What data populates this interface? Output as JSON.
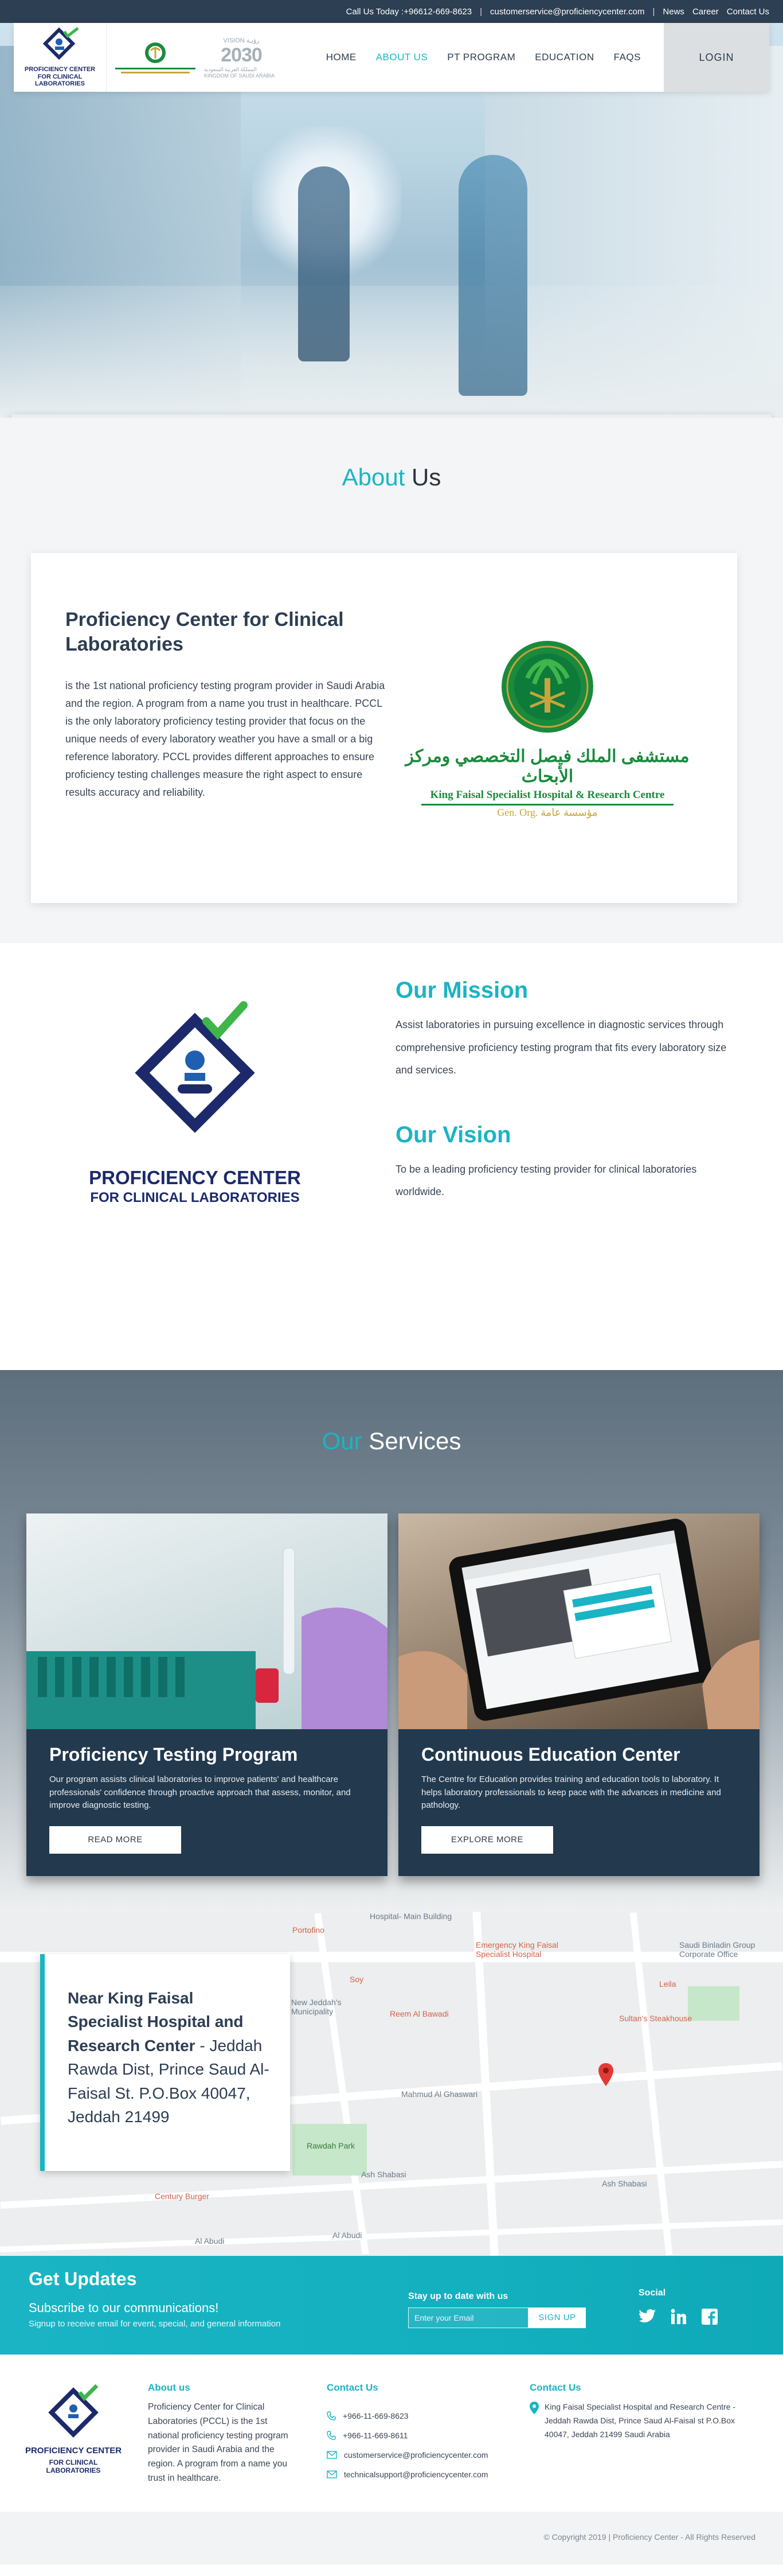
{
  "topbar": {
    "call": "Call Us Today :+96612-669-8623",
    "email": "customerservice@proficiencycenter.com",
    "links": [
      "News",
      "Career",
      "Contact Us"
    ],
    "separator": "|"
  },
  "header": {
    "logo_line1": "PROFICIENCY CENTER",
    "logo_line2": "FOR CLINICAL LABORATORIES",
    "vision_prefix": "VISION رؤيـة",
    "vision_year": "2030",
    "vision_sub": "المملكة العربية السعودية KINGDOM OF SAUDI ARABIA",
    "nav": [
      "HOME",
      "ABOUT US",
      "PT PROGRAM",
      "EDUCATION",
      "FAQS"
    ],
    "active_nav": "ABOUT US",
    "login": "LOGIN"
  },
  "about": {
    "title_accent": "About",
    "title_rest": " Us",
    "card_title": "Proficiency Center for Clinical Laboratories",
    "card_text": "is the 1st national proficiency testing program provider in Saudi Arabia and the region. A program from a name you trust in healthcare. PCCL is the only laboratory proficiency testing provider that focus on the unique needs of every laboratory weather you have a small or a big reference laboratory. PCCL provides different approaches to ensure proficiency testing challenges measure the right aspect to ensure results accuracy and reliability.",
    "kf_arabic": "مستشفى الملك فيصل التخصصي ومركز الأبحاث",
    "kf_english": "King Faisal Specialist Hospital & Research Centre",
    "kf_org": "Gen. Org. مؤسسة عامة"
  },
  "mission": {
    "logo_line1": "PROFICIENCY CENTER",
    "logo_line2": "FOR CLINICAL LABORATORIES",
    "mission_title": "Our Mission",
    "mission_text": "Assist laboratories in pursuing excellence in diagnostic services through comprehensive proficiency testing program that fits every laboratory size and services.",
    "vision_title": "Our Vision",
    "vision_text": "To be a leading proficiency testing provider for clinical laboratories worldwide."
  },
  "services": {
    "title_accent": "Our",
    "title_rest": " Services",
    "cards": [
      {
        "title": "Proficiency Testing Program",
        "text": "Our program assists clinical laboratories to improve patients' and healthcare professionals' confidence through proactive approach that assess, monitor, and improve diagnostic testing.",
        "button": "READ MORE"
      },
      {
        "title": "Continuous Education Center",
        "text": "The Centre for Education provides training and education tools to laboratory. It helps laboratory professionals to keep pace with the advances in medicine and pathology.",
        "button": "EXPLORE MORE"
      }
    ]
  },
  "map": {
    "address_bold": "Near King Faisal Specialist Hospital and Research Center",
    "address_rest": " - Jeddah Rawda Dist, Prince Saud Al-Faisal St.  P.O.Box 40047, Jeddah 21499",
    "labels": {
      "portofino": "Portofino",
      "emergency": "Emergency King Faisal Specialist Hospital",
      "saudi_binladin": "Saudi Binladin Group Corporate Office",
      "leila": "Leila",
      "new_jeddah": "New Jeddah's Municipality",
      "reem": "Reem Al Bawadi",
      "sultans": "Sultan's Steakhouse",
      "mahmud": "Mahmud Al Ghaswari",
      "rawdah": "Rawdah Park",
      "ash_shabasi": "Ash Shabasi",
      "century": "Century Burger",
      "al_abudi": "Al Abudi",
      "soy": "Soy",
      "hospital_main": "Hospital- Main Building"
    }
  },
  "updates": {
    "title": "Get Updates",
    "subtitle": "Subscribe to our communications!",
    "note": "Signup to receive email for event, special, and general information",
    "stay": "Stay up to date with us",
    "email_placeholder": "Enter your Email",
    "signup": "SIGN UP",
    "social": "Social"
  },
  "footer": {
    "logo_line1": "PROFICIENCY CENTER",
    "logo_line2": "FOR CLINICAL LABORATORIES",
    "about_title": "About us",
    "about_text": "Proficiency Center for Clinical Laboratories (PCCL) is the 1st national proficiency testing program provider in Saudi Arabia and the region. A program from a name you trust in healthcare.",
    "contact_title": "Contact Us",
    "phone1": "+966-11-669-8623",
    "phone2": "+966-11-669-8611",
    "email1": "customerservice@proficiencycenter.com",
    "email2": "technicalsupport@proficiencycenter.com",
    "contact_title2": "Contact Us",
    "address": "King Faisal Specialist Hospital and Research Centre - Jeddah Rawda Dist, Prince Saud Al-Faisal st  P.O.Box 40047, Jeddah 21499 Saudi Arabia"
  },
  "copyright": "© Copyright  2019  |  Proficiency Center - All Rights Reserved"
}
